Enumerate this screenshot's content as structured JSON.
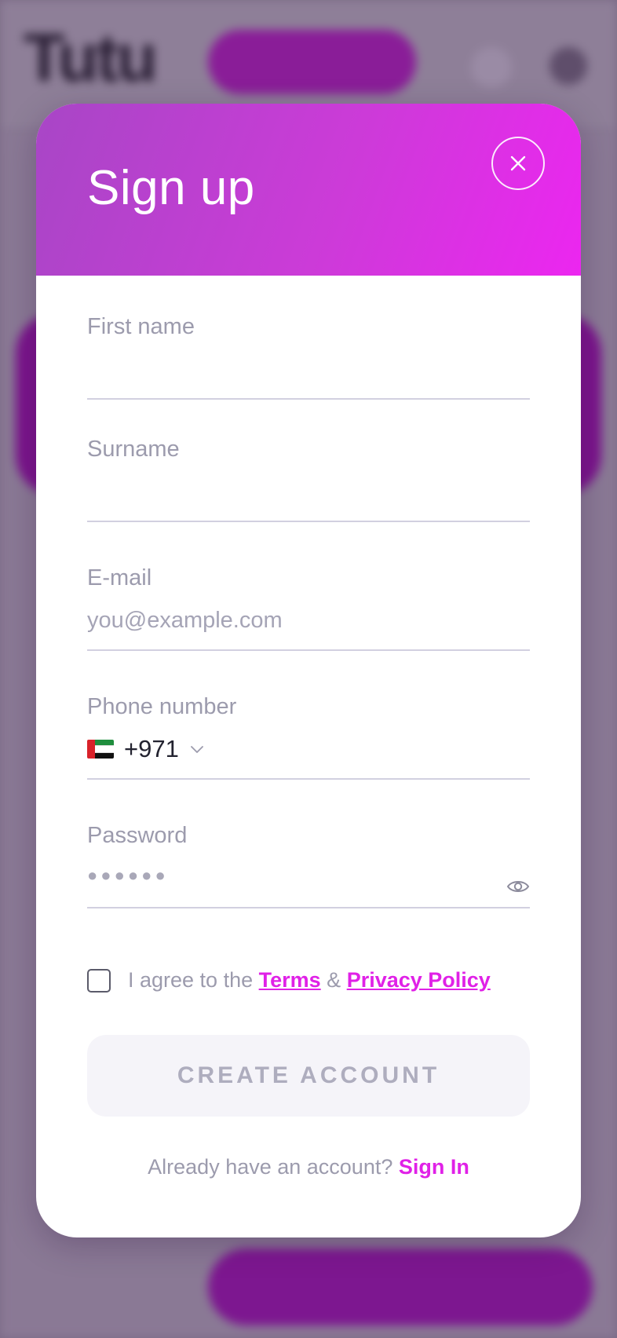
{
  "modal": {
    "title": "Sign up"
  },
  "form": {
    "first_name": {
      "label": "First name",
      "value": "",
      "placeholder": ""
    },
    "surname": {
      "label": "Surname",
      "value": "",
      "placeholder": ""
    },
    "email": {
      "label": "E-mail",
      "value": "",
      "placeholder": "you@example.com"
    },
    "phone": {
      "label": "Phone number",
      "country_code": "+971",
      "flag_icon": "uae-flag-icon",
      "value": ""
    },
    "password": {
      "label": "Password",
      "masked_value": "●●●●●●",
      "toggle_icon": "eye-icon"
    }
  },
  "agreement": {
    "prefix": "I agree to the ",
    "terms_link": "Terms",
    "conjunction": " & ",
    "privacy_link": "Privacy Policy",
    "checked": false
  },
  "actions": {
    "create_account": "CREATE ACCOUNT",
    "signin_prompt": "Already have an account? ",
    "signin_link": "Sign In"
  },
  "colors": {
    "accent": "#e021e7",
    "header_gradient_start": "#a846c6",
    "header_gradient_end": "#ec26f0",
    "label": "#9c9bad",
    "button_bg": "#f5f4f9",
    "button_text": "#aeadbe"
  }
}
